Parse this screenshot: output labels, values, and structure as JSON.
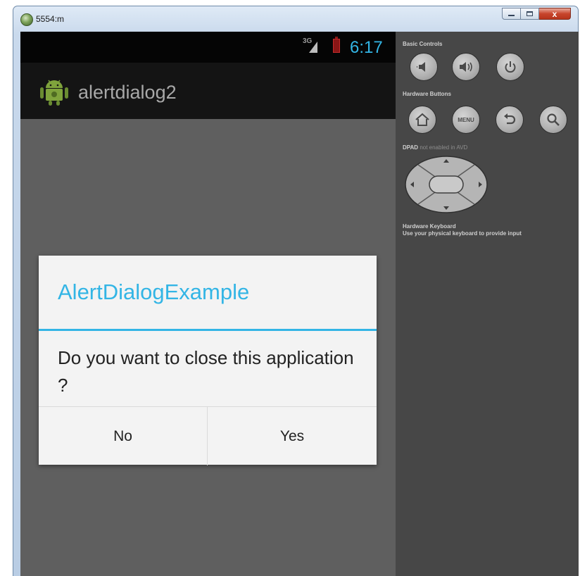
{
  "window": {
    "title": "5554:m",
    "close_glyph": "x"
  },
  "device": {
    "network_label": "3G",
    "clock": "6:17",
    "app_name": "alertdialog2"
  },
  "dialog": {
    "title": "AlertDialogExample",
    "message": "Do you want to close this application ?",
    "negative_button": "No",
    "positive_button": "Yes"
  },
  "controls": {
    "basic_controls_label": "Basic Controls",
    "hardware_buttons_label": "Hardware Buttons",
    "menu_label": "MENU",
    "dpad_label": "DPAD",
    "dpad_note": "not enabled in AVD",
    "keyboard_label": "Hardware Keyboard",
    "keyboard_note": "Use your physical keyboard to provide input",
    "icons": [
      "volume-down-icon",
      "volume-up-icon",
      "power-icon",
      "home-icon",
      "menu-icon",
      "back-icon",
      "search-icon",
      "dpad"
    ]
  },
  "colors": {
    "accent": "#33b5e5",
    "screen_background": "#5f5f5f",
    "panel_background": "#474747",
    "battery": "#8a1616"
  }
}
